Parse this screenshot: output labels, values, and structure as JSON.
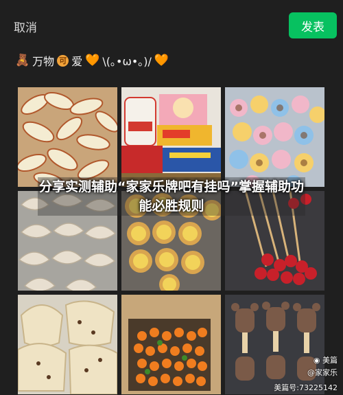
{
  "topbar": {
    "cancel_label": "取消",
    "post_label": "发表",
    "post_color": "#07c160"
  },
  "caption": {
    "prefix_icon": "teddy-bear-emoji",
    "text_1": "万物",
    "coin_icon": "coin-emoji",
    "coin_glyph": "可",
    "text_2": "爱",
    "heart_icon": "orange-heart-emoji",
    "kaomoji": "\\(｡•ω•｡)/",
    "suffix_icon": "orange-heart-emoji"
  },
  "photos": [
    {
      "subject": "apple slices"
    },
    {
      "subject": "snack packages"
    },
    {
      "subject": "cupcakes"
    },
    {
      "subject": "dumplings"
    },
    {
      "subject": "egg tarts"
    },
    {
      "subject": "candied strawberry skewers"
    },
    {
      "subject": "bread"
    },
    {
      "subject": "kumquats in box"
    },
    {
      "subject": "bear-shaped chocolate molds"
    }
  ],
  "overlay": {
    "title": "分享实测辅助“家家乐牌吧有挂吗”掌握辅助功能必胜规则"
  },
  "watermark": {
    "brand": "美篇",
    "author": "@家家乐",
    "id_line": "美篇号:73225142"
  }
}
